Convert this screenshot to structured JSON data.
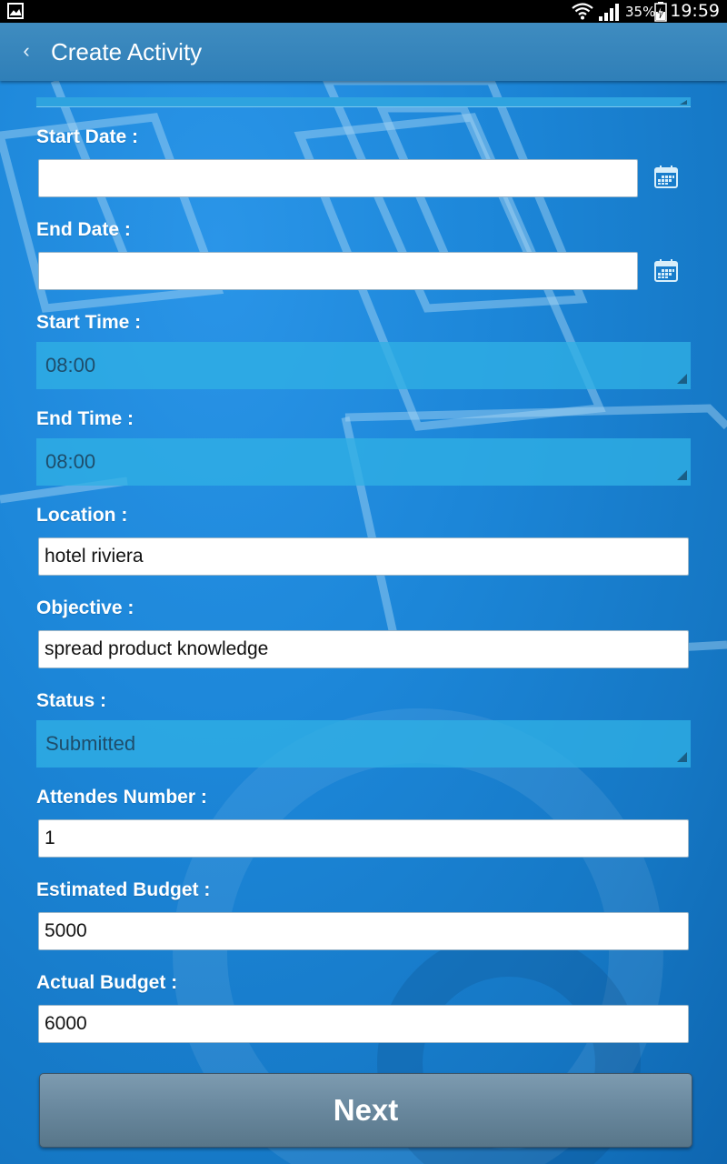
{
  "status_bar": {
    "battery_percent": "35%",
    "time": "19:59"
  },
  "action_bar": {
    "back_glyph": "‹",
    "title": "Create Activity"
  },
  "form": {
    "start_date": {
      "label": "Start Date :",
      "value": ""
    },
    "end_date": {
      "label": "End Date :",
      "value": ""
    },
    "start_time": {
      "label": "Start Time :",
      "value": "08:00"
    },
    "end_time": {
      "label": "End Time :",
      "value": "08:00"
    },
    "location": {
      "label": "Location :",
      "value": "hotel riviera"
    },
    "objective": {
      "label": "Objective :",
      "value": "spread product knowledge"
    },
    "status": {
      "label": "Status :",
      "value": "Submitted"
    },
    "attendees": {
      "label": "Attendes Number :",
      "value": "1"
    },
    "estimated_budget": {
      "label": "Estimated Budget :",
      "value": "5000"
    },
    "actual_budget": {
      "label": "Actual Budget :",
      "value": "6000"
    }
  },
  "next_button": {
    "label": "Next"
  },
  "icons": {
    "status_left": "gallery-icon",
    "wifi": "wifi-icon",
    "signal": "signal-icon",
    "battery": "battery-charging-icon",
    "date_picker": "calendar-icon",
    "spinner": "dropdown-triangle-icon"
  },
  "colors": {
    "action_bar": "#3a88bd",
    "background": "#1a7fcf",
    "spinner": "#30b0e4",
    "button": "#6a899f"
  }
}
